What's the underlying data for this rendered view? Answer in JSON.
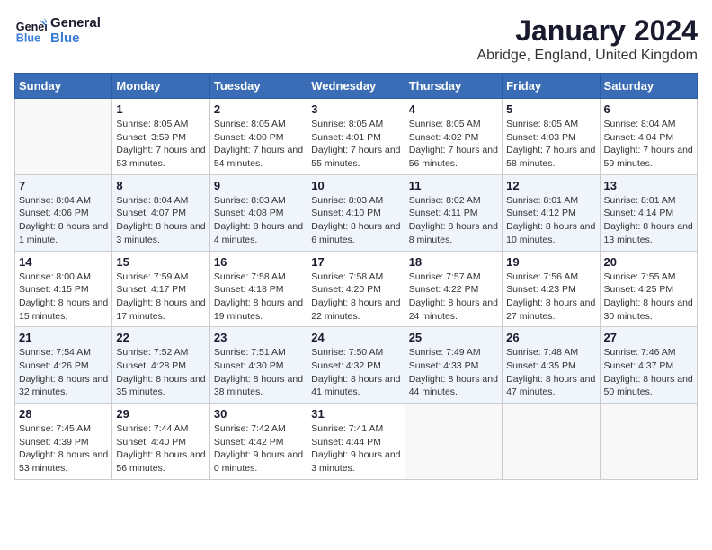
{
  "header": {
    "logo_general": "General",
    "logo_blue": "Blue",
    "month_title": "January 2024",
    "location": "Abridge, England, United Kingdom"
  },
  "days_of_week": [
    "Sunday",
    "Monday",
    "Tuesday",
    "Wednesday",
    "Thursday",
    "Friday",
    "Saturday"
  ],
  "weeks": [
    [
      {
        "day": "",
        "sunrise": "",
        "sunset": "",
        "daylight": "",
        "empty": true
      },
      {
        "day": "1",
        "sunrise": "Sunrise: 8:05 AM",
        "sunset": "Sunset: 3:59 PM",
        "daylight": "Daylight: 7 hours and 53 minutes.",
        "empty": false
      },
      {
        "day": "2",
        "sunrise": "Sunrise: 8:05 AM",
        "sunset": "Sunset: 4:00 PM",
        "daylight": "Daylight: 7 hours and 54 minutes.",
        "empty": false
      },
      {
        "day": "3",
        "sunrise": "Sunrise: 8:05 AM",
        "sunset": "Sunset: 4:01 PM",
        "daylight": "Daylight: 7 hours and 55 minutes.",
        "empty": false
      },
      {
        "day": "4",
        "sunrise": "Sunrise: 8:05 AM",
        "sunset": "Sunset: 4:02 PM",
        "daylight": "Daylight: 7 hours and 56 minutes.",
        "empty": false
      },
      {
        "day": "5",
        "sunrise": "Sunrise: 8:05 AM",
        "sunset": "Sunset: 4:03 PM",
        "daylight": "Daylight: 7 hours and 58 minutes.",
        "empty": false
      },
      {
        "day": "6",
        "sunrise": "Sunrise: 8:04 AM",
        "sunset": "Sunset: 4:04 PM",
        "daylight": "Daylight: 7 hours and 59 minutes.",
        "empty": false
      }
    ],
    [
      {
        "day": "7",
        "sunrise": "Sunrise: 8:04 AM",
        "sunset": "Sunset: 4:06 PM",
        "daylight": "Daylight: 8 hours and 1 minute.",
        "empty": false
      },
      {
        "day": "8",
        "sunrise": "Sunrise: 8:04 AM",
        "sunset": "Sunset: 4:07 PM",
        "daylight": "Daylight: 8 hours and 3 minutes.",
        "empty": false
      },
      {
        "day": "9",
        "sunrise": "Sunrise: 8:03 AM",
        "sunset": "Sunset: 4:08 PM",
        "daylight": "Daylight: 8 hours and 4 minutes.",
        "empty": false
      },
      {
        "day": "10",
        "sunrise": "Sunrise: 8:03 AM",
        "sunset": "Sunset: 4:10 PM",
        "daylight": "Daylight: 8 hours and 6 minutes.",
        "empty": false
      },
      {
        "day": "11",
        "sunrise": "Sunrise: 8:02 AM",
        "sunset": "Sunset: 4:11 PM",
        "daylight": "Daylight: 8 hours and 8 minutes.",
        "empty": false
      },
      {
        "day": "12",
        "sunrise": "Sunrise: 8:01 AM",
        "sunset": "Sunset: 4:12 PM",
        "daylight": "Daylight: 8 hours and 10 minutes.",
        "empty": false
      },
      {
        "day": "13",
        "sunrise": "Sunrise: 8:01 AM",
        "sunset": "Sunset: 4:14 PM",
        "daylight": "Daylight: 8 hours and 13 minutes.",
        "empty": false
      }
    ],
    [
      {
        "day": "14",
        "sunrise": "Sunrise: 8:00 AM",
        "sunset": "Sunset: 4:15 PM",
        "daylight": "Daylight: 8 hours and 15 minutes.",
        "empty": false
      },
      {
        "day": "15",
        "sunrise": "Sunrise: 7:59 AM",
        "sunset": "Sunset: 4:17 PM",
        "daylight": "Daylight: 8 hours and 17 minutes.",
        "empty": false
      },
      {
        "day": "16",
        "sunrise": "Sunrise: 7:58 AM",
        "sunset": "Sunset: 4:18 PM",
        "daylight": "Daylight: 8 hours and 19 minutes.",
        "empty": false
      },
      {
        "day": "17",
        "sunrise": "Sunrise: 7:58 AM",
        "sunset": "Sunset: 4:20 PM",
        "daylight": "Daylight: 8 hours and 22 minutes.",
        "empty": false
      },
      {
        "day": "18",
        "sunrise": "Sunrise: 7:57 AM",
        "sunset": "Sunset: 4:22 PM",
        "daylight": "Daylight: 8 hours and 24 minutes.",
        "empty": false
      },
      {
        "day": "19",
        "sunrise": "Sunrise: 7:56 AM",
        "sunset": "Sunset: 4:23 PM",
        "daylight": "Daylight: 8 hours and 27 minutes.",
        "empty": false
      },
      {
        "day": "20",
        "sunrise": "Sunrise: 7:55 AM",
        "sunset": "Sunset: 4:25 PM",
        "daylight": "Daylight: 8 hours and 30 minutes.",
        "empty": false
      }
    ],
    [
      {
        "day": "21",
        "sunrise": "Sunrise: 7:54 AM",
        "sunset": "Sunset: 4:26 PM",
        "daylight": "Daylight: 8 hours and 32 minutes.",
        "empty": false
      },
      {
        "day": "22",
        "sunrise": "Sunrise: 7:52 AM",
        "sunset": "Sunset: 4:28 PM",
        "daylight": "Daylight: 8 hours and 35 minutes.",
        "empty": false
      },
      {
        "day": "23",
        "sunrise": "Sunrise: 7:51 AM",
        "sunset": "Sunset: 4:30 PM",
        "daylight": "Daylight: 8 hours and 38 minutes.",
        "empty": false
      },
      {
        "day": "24",
        "sunrise": "Sunrise: 7:50 AM",
        "sunset": "Sunset: 4:32 PM",
        "daylight": "Daylight: 8 hours and 41 minutes.",
        "empty": false
      },
      {
        "day": "25",
        "sunrise": "Sunrise: 7:49 AM",
        "sunset": "Sunset: 4:33 PM",
        "daylight": "Daylight: 8 hours and 44 minutes.",
        "empty": false
      },
      {
        "day": "26",
        "sunrise": "Sunrise: 7:48 AM",
        "sunset": "Sunset: 4:35 PM",
        "daylight": "Daylight: 8 hours and 47 minutes.",
        "empty": false
      },
      {
        "day": "27",
        "sunrise": "Sunrise: 7:46 AM",
        "sunset": "Sunset: 4:37 PM",
        "daylight": "Daylight: 8 hours and 50 minutes.",
        "empty": false
      }
    ],
    [
      {
        "day": "28",
        "sunrise": "Sunrise: 7:45 AM",
        "sunset": "Sunset: 4:39 PM",
        "daylight": "Daylight: 8 hours and 53 minutes.",
        "empty": false
      },
      {
        "day": "29",
        "sunrise": "Sunrise: 7:44 AM",
        "sunset": "Sunset: 4:40 PM",
        "daylight": "Daylight: 8 hours and 56 minutes.",
        "empty": false
      },
      {
        "day": "30",
        "sunrise": "Sunrise: 7:42 AM",
        "sunset": "Sunset: 4:42 PM",
        "daylight": "Daylight: 9 hours and 0 minutes.",
        "empty": false
      },
      {
        "day": "31",
        "sunrise": "Sunrise: 7:41 AM",
        "sunset": "Sunset: 4:44 PM",
        "daylight": "Daylight: 9 hours and 3 minutes.",
        "empty": false
      },
      {
        "day": "",
        "sunrise": "",
        "sunset": "",
        "daylight": "",
        "empty": true
      },
      {
        "day": "",
        "sunrise": "",
        "sunset": "",
        "daylight": "",
        "empty": true
      },
      {
        "day": "",
        "sunrise": "",
        "sunset": "",
        "daylight": "",
        "empty": true
      }
    ]
  ]
}
